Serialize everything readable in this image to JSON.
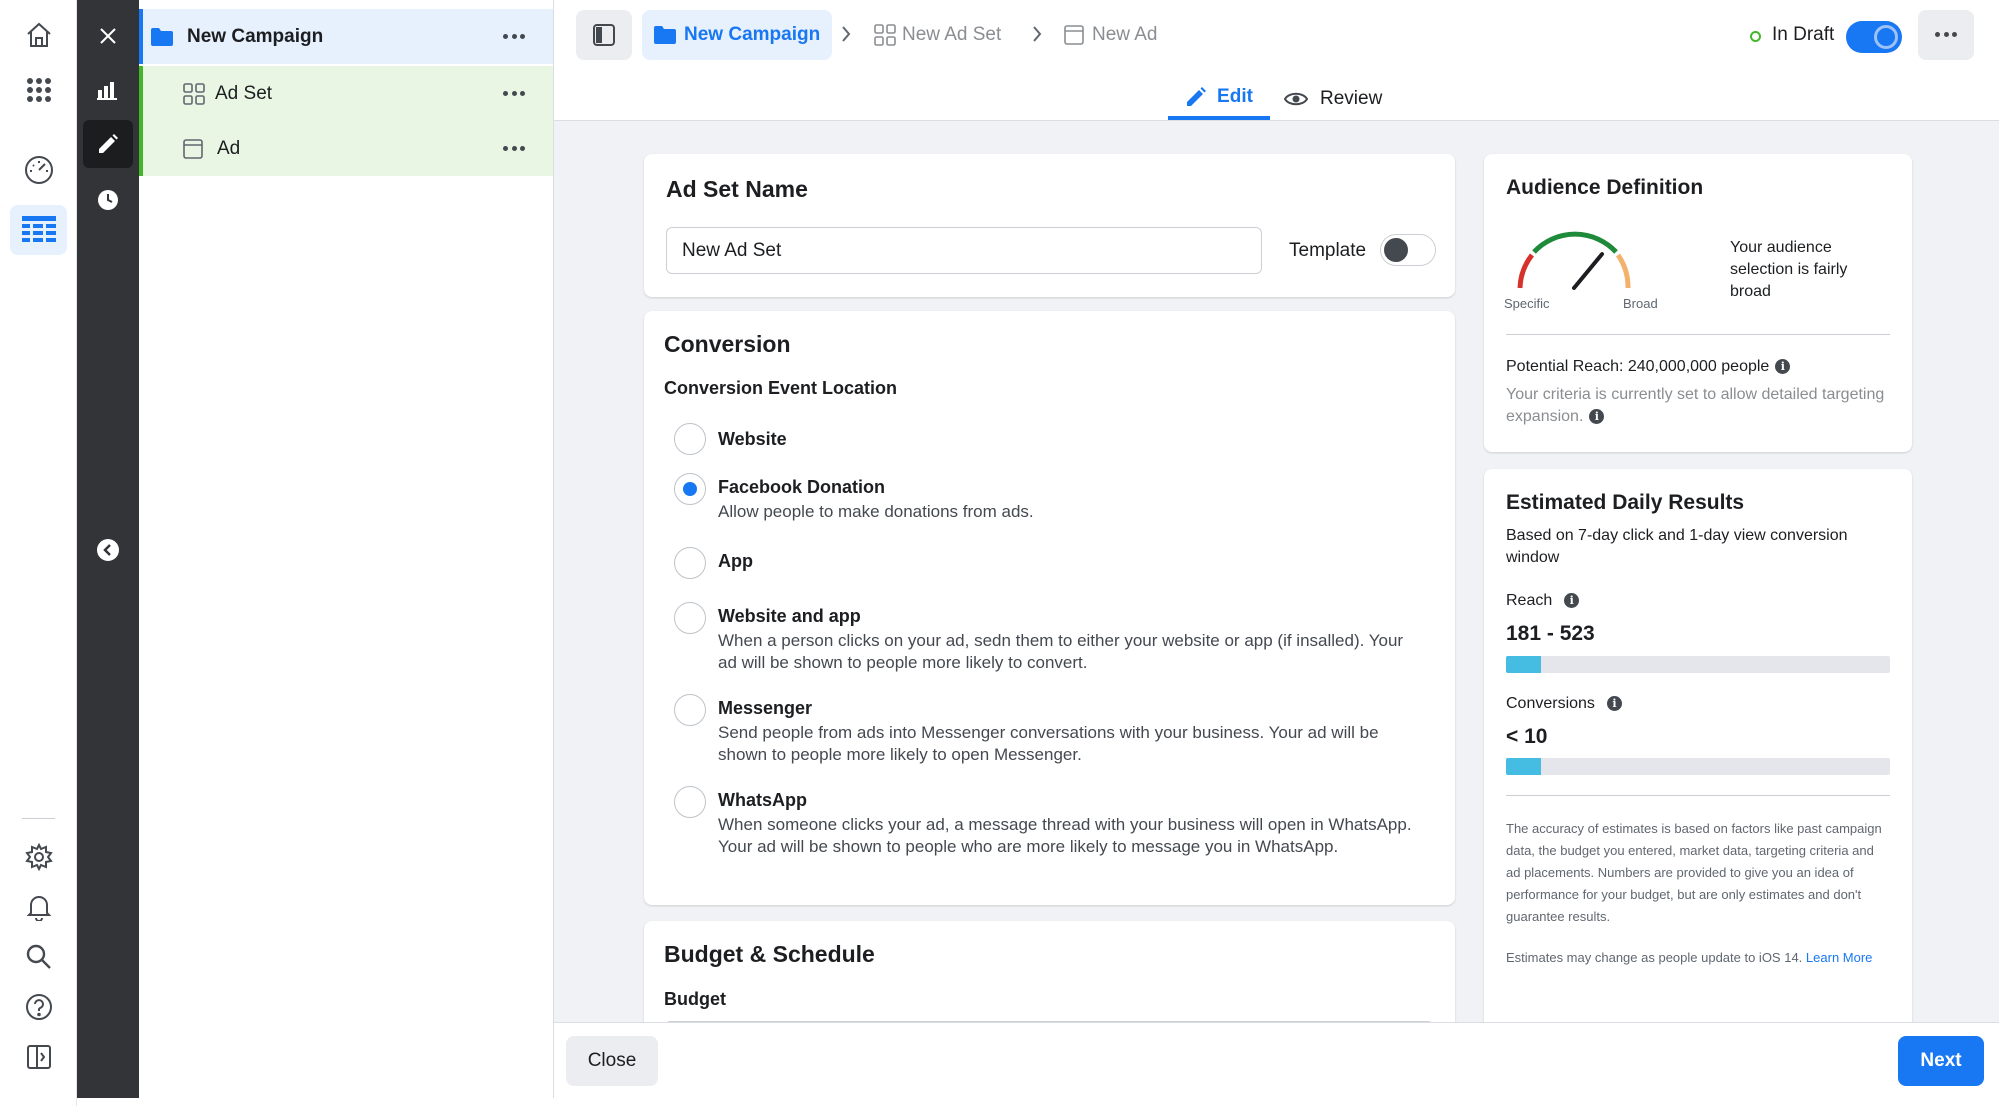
{
  "tree": {
    "campaign_label": "New Campaign",
    "adset_label": "Ad Set",
    "ad_label": "Ad"
  },
  "header": {
    "crumb_campaign": "New Campaign",
    "crumb_adset": "New Ad Set",
    "crumb_ad": "New Ad",
    "status_label": "In Draft",
    "status_toggle_on": true,
    "tab_edit": "Edit",
    "tab_review": "Review"
  },
  "adset_name": {
    "title": "Ad Set Name",
    "input_value": "New Ad Set",
    "template_label": "Template",
    "template_toggle_on": false
  },
  "conversion": {
    "title": "Conversion",
    "subtitle": "Conversion Event Location",
    "options": [
      {
        "title": "Website",
        "desc": "",
        "checked": false
      },
      {
        "title": "Facebook Donation",
        "desc": "Allow people to make donations from ads.",
        "checked": true
      },
      {
        "title": "App",
        "desc": "",
        "checked": false
      },
      {
        "title": "Website and app",
        "desc": "When a person clicks on your ad, sedn them to either your website or app (if insalled). Your ad will be shown to people more likely to convert.",
        "checked": false
      },
      {
        "title": "Messenger",
        "desc": "Send people from ads into Messenger conversations with your business. Your ad will be shown to people more likely to open Messenger.",
        "checked": false
      },
      {
        "title": "WhatsApp",
        "desc": "When someone clicks your ad, a message thread with your business will open in WhatsApp. Your ad will be shown to people who are more likely to message you in WhatsApp.",
        "checked": false
      }
    ]
  },
  "budget": {
    "title": "Budget & Schedule",
    "subtitle": "Budget"
  },
  "audience": {
    "title": "Audience Definition",
    "gauge_left": "Specific",
    "gauge_right": "Broad",
    "gauge_level": 0.72,
    "gauge_text": "Your audience selection is fairly broad",
    "potential_reach": "Potential Reach: 240,000,000 people",
    "criteria_note": "Your criteria is currently set to allow detailed targeting expansion."
  },
  "estimates": {
    "title": "Estimated Daily Results",
    "subtitle": "Based on 7-day click and 1-day view conversion window",
    "reach_label": "Reach",
    "reach_value": "181 - 523",
    "reach_fill": 0.09,
    "conversions_label": "Conversions",
    "conversions_value": "< 10",
    "conversions_fill": 0.09,
    "disclaimer": "The accuracy of estimates is based on factors like past campaign data, the budget you entered, market data, targeting criteria and ad placements. Numbers are provided to give you an idea of performance for your budget, but are only estimates and don't guarantee results.",
    "ios_note": "Estimates may change as people update to iOS 14.",
    "learn_more": "Learn More"
  },
  "footer": {
    "close_label": "Close",
    "next_label": "Next"
  },
  "colors": {
    "accent": "#1877f2",
    "draft_green": "#42b72a",
    "bar_fill": "#45bde3",
    "dark_column": "#323437"
  }
}
